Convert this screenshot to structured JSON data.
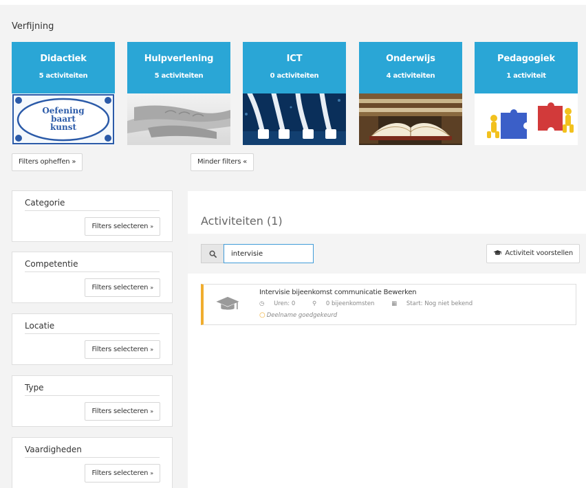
{
  "refinement": {
    "title": "Verfijning",
    "tiles": [
      {
        "name": "Didactiek",
        "count": "5 activiteiten",
        "image": "oefening-baart-kunst-tile",
        "image_text": "Oefening baart kunst"
      },
      {
        "name": "Hulpverlening",
        "count": "5 activiteiten",
        "image": "holding-hands-photo"
      },
      {
        "name": "ICT",
        "count": "0 activiteiten",
        "image": "network-cables-photo"
      },
      {
        "name": "Onderwijs",
        "count": "4 activiteiten",
        "image": "open-books-photo"
      },
      {
        "name": "Pedagogiek",
        "count": "1 activiteit",
        "image": "puzzle-figures-image"
      }
    ],
    "clear_filters": "Filters opheffen »",
    "less_filters": "Minder filters «",
    "tile_color": "#2aa6d6"
  },
  "facets": [
    {
      "title": "Categorie",
      "button": "Filters selecteren"
    },
    {
      "title": "Competentie",
      "button": "Filters selecteren"
    },
    {
      "title": "Locatie",
      "button": "Filters selecteren"
    },
    {
      "title": "Type",
      "button": "Filters selecteren"
    },
    {
      "title": "Vaardigheden",
      "button": "Filters selecteren"
    }
  ],
  "main": {
    "title": "Activiteiten (1)",
    "search": {
      "value": "intervisie",
      "icon": "search-icon"
    },
    "propose_button": "Activiteit voorstellen",
    "activities": [
      {
        "title": "Intervisie bijeenkomst communicatie Bewerken",
        "hours": "Uren: 0",
        "meetings": "0 bijeenkomsten",
        "start": "Start: Nog niet bekend",
        "status": "Deelname goedgekeurd",
        "icon": "graduation-cap-icon",
        "accent_color": "#f0ad2e"
      }
    ]
  }
}
